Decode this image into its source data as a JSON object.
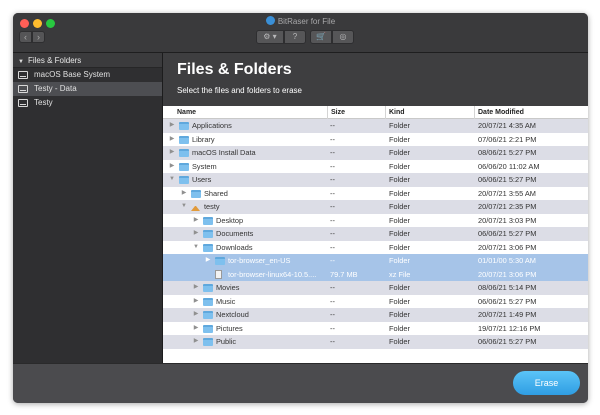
{
  "app": {
    "title": "BitRaser for File"
  },
  "toolbar": {
    "back": "‹",
    "forward": "›",
    "gear": "⚙ ▾",
    "help": "?",
    "cart": "🛒",
    "disc": "◎"
  },
  "sidebar": {
    "header": "Files & Folders",
    "items": [
      {
        "label": "macOS Base System",
        "icon": "drive-icon",
        "selected": false
      },
      {
        "label": "Testy - Data",
        "icon": "drive-icon",
        "selected": true
      },
      {
        "label": "Testy",
        "icon": "drive-icon",
        "selected": false
      }
    ]
  },
  "main": {
    "title": "Files & Folders",
    "subtitle": "Select the files and folders to erase"
  },
  "table": {
    "columns": [
      "Name",
      "Size",
      "Kind",
      "Date Modified"
    ],
    "rows": [
      {
        "depth": 0,
        "expanded": false,
        "icon": "folder-icon",
        "name": "Applications",
        "size": "--",
        "kind": "Folder",
        "date": "20/07/21 4:35 AM"
      },
      {
        "depth": 0,
        "expanded": false,
        "icon": "folder-icon",
        "name": "Library",
        "size": "--",
        "kind": "Folder",
        "date": "07/06/21 2:21 PM"
      },
      {
        "depth": 0,
        "expanded": false,
        "icon": "folder-icon",
        "name": "macOS Install Data",
        "size": "--",
        "kind": "Folder",
        "date": "08/06/21 5:27 PM"
      },
      {
        "depth": 0,
        "expanded": false,
        "icon": "folder-icon",
        "name": "System",
        "size": "--",
        "kind": "Folder",
        "date": "06/06/20 11:02 AM"
      },
      {
        "depth": 0,
        "expanded": true,
        "icon": "folder-icon",
        "name": "Users",
        "size": "--",
        "kind": "Folder",
        "date": "06/06/21 5:27 PM"
      },
      {
        "depth": 1,
        "expanded": false,
        "icon": "folder-icon",
        "name": "Shared",
        "size": "--",
        "kind": "Folder",
        "date": "20/07/21 3:55 AM"
      },
      {
        "depth": 1,
        "expanded": true,
        "icon": "home-icon",
        "name": "testy",
        "size": "--",
        "kind": "Folder",
        "date": "20/07/21 2:35 PM"
      },
      {
        "depth": 2,
        "expanded": false,
        "icon": "folder-icon",
        "name": "Desktop",
        "size": "--",
        "kind": "Folder",
        "date": "20/07/21 3:03 PM"
      },
      {
        "depth": 2,
        "expanded": false,
        "icon": "folder-icon",
        "name": "Documents",
        "size": "--",
        "kind": "Folder",
        "date": "06/06/21 5:27 PM"
      },
      {
        "depth": 2,
        "expanded": true,
        "icon": "folder-icon",
        "name": "Downloads",
        "size": "--",
        "kind": "Folder",
        "date": "20/07/21 3:06 PM"
      },
      {
        "depth": 3,
        "expanded": false,
        "icon": "folder-icon",
        "name": "tor-browser_en-US",
        "size": "--",
        "kind": "Folder",
        "date": "01/01/00 5:30 AM",
        "selected": true
      },
      {
        "depth": 3,
        "leaf": true,
        "icon": "file-icon",
        "name": "tor-browser-linux64-10.5....",
        "size": "79.7 MB",
        "kind": "xz File",
        "date": "20/07/21 3:06 PM",
        "selected": true
      },
      {
        "depth": 2,
        "expanded": false,
        "icon": "folder-icon",
        "name": "Movies",
        "size": "--",
        "kind": "Folder",
        "date": "08/06/21 5:14 PM"
      },
      {
        "depth": 2,
        "expanded": false,
        "icon": "folder-icon",
        "name": "Music",
        "size": "--",
        "kind": "Folder",
        "date": "06/06/21 5:27 PM"
      },
      {
        "depth": 2,
        "expanded": false,
        "icon": "folder-icon",
        "name": "Nextcloud",
        "size": "--",
        "kind": "Folder",
        "date": "20/07/21 1:49 PM"
      },
      {
        "depth": 2,
        "expanded": false,
        "icon": "folder-icon",
        "name": "Pictures",
        "size": "--",
        "kind": "Folder",
        "date": "19/07/21 12:16 PM"
      },
      {
        "depth": 2,
        "expanded": false,
        "icon": "folder-icon",
        "name": "Public",
        "size": "--",
        "kind": "Folder",
        "date": "06/06/21 5:27 PM"
      }
    ]
  },
  "footer": {
    "erase_label": "Erase"
  },
  "colors": {
    "accent": "#3aa3e8",
    "selection": "#a6c4e8",
    "folder": "#7ec0ee"
  }
}
